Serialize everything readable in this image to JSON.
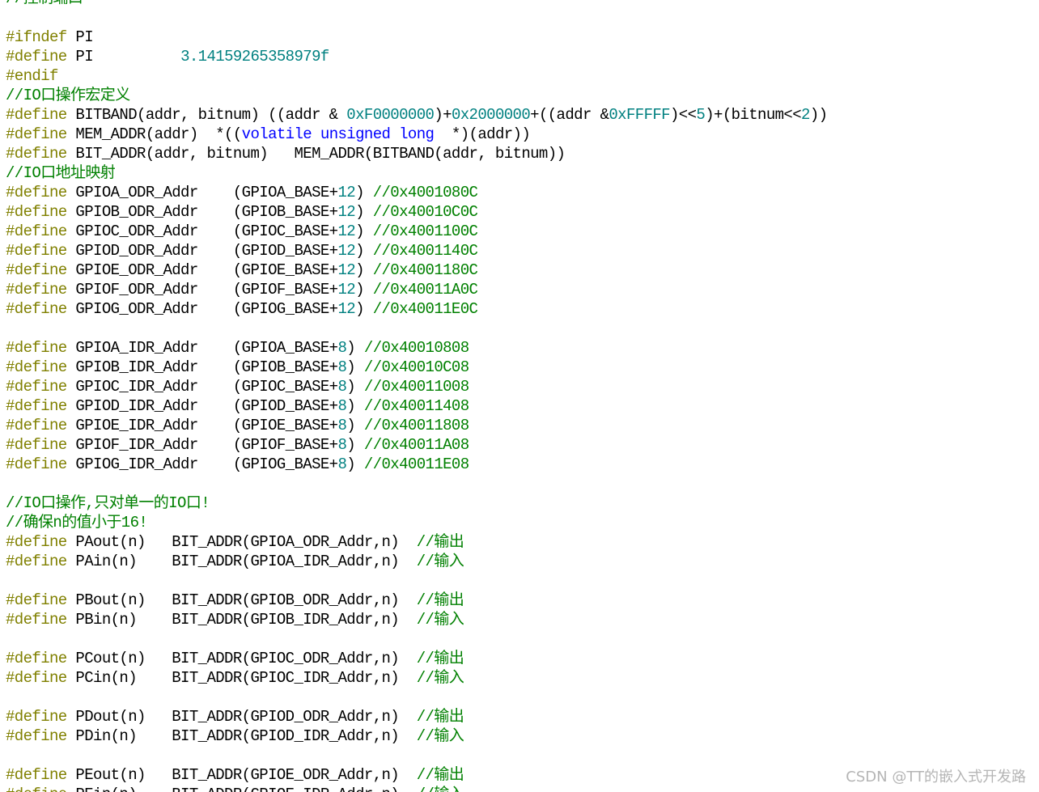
{
  "code_lines": [
    [
      [
        "cmt",
        "//控制端口"
      ]
    ],
    [],
    [
      [
        "pp",
        "#ifndef"
      ],
      [
        "id",
        " PI"
      ]
    ],
    [
      [
        "pp",
        "#define"
      ],
      [
        "id",
        " PI          "
      ],
      [
        "num",
        "3.14159265358979f"
      ]
    ],
    [
      [
        "pp",
        "#endif"
      ]
    ],
    [
      [
        "cmt",
        "//IO口操作宏定义"
      ]
    ],
    [
      [
        "pp",
        "#define"
      ],
      [
        "id",
        " BITBAND(addr, bitnum) ((addr & "
      ],
      [
        "num",
        "0xF0000000"
      ],
      [
        "id",
        ")+"
      ],
      [
        "num",
        "0x2000000"
      ],
      [
        "id",
        "+((addr &"
      ],
      [
        "num",
        "0xFFFFF"
      ],
      [
        "id",
        ")<<"
      ],
      [
        "num",
        "5"
      ],
      [
        "id",
        ")+(bitnum<<"
      ],
      [
        "num",
        "2"
      ],
      [
        "id",
        "))"
      ]
    ],
    [
      [
        "pp",
        "#define"
      ],
      [
        "id",
        " MEM_ADDR(addr)  *(("
      ],
      [
        "kw",
        "volatile unsigned long"
      ],
      [
        "id",
        "  *)(addr))"
      ]
    ],
    [
      [
        "pp",
        "#define"
      ],
      [
        "id",
        " BIT_ADDR(addr, bitnum)   MEM_ADDR(BITBAND(addr, bitnum))"
      ]
    ],
    [
      [
        "cmt",
        "//IO口地址映射"
      ]
    ],
    [
      [
        "pp",
        "#define"
      ],
      [
        "id",
        " GPIOA_ODR_Addr    (GPIOA_BASE+"
      ],
      [
        "num",
        "12"
      ],
      [
        "id",
        ") "
      ],
      [
        "cmt",
        "//0x4001080C"
      ]
    ],
    [
      [
        "pp",
        "#define"
      ],
      [
        "id",
        " GPIOB_ODR_Addr    (GPIOB_BASE+"
      ],
      [
        "num",
        "12"
      ],
      [
        "id",
        ") "
      ],
      [
        "cmt",
        "//0x40010C0C"
      ]
    ],
    [
      [
        "pp",
        "#define"
      ],
      [
        "id",
        " GPIOC_ODR_Addr    (GPIOC_BASE+"
      ],
      [
        "num",
        "12"
      ],
      [
        "id",
        ") "
      ],
      [
        "cmt",
        "//0x4001100C"
      ]
    ],
    [
      [
        "pp",
        "#define"
      ],
      [
        "id",
        " GPIOD_ODR_Addr    (GPIOD_BASE+"
      ],
      [
        "num",
        "12"
      ],
      [
        "id",
        ") "
      ],
      [
        "cmt",
        "//0x4001140C"
      ]
    ],
    [
      [
        "pp",
        "#define"
      ],
      [
        "id",
        " GPIOE_ODR_Addr    (GPIOE_BASE+"
      ],
      [
        "num",
        "12"
      ],
      [
        "id",
        ") "
      ],
      [
        "cmt",
        "//0x4001180C"
      ]
    ],
    [
      [
        "pp",
        "#define"
      ],
      [
        "id",
        " GPIOF_ODR_Addr    (GPIOF_BASE+"
      ],
      [
        "num",
        "12"
      ],
      [
        "id",
        ") "
      ],
      [
        "cmt",
        "//0x40011A0C"
      ]
    ],
    [
      [
        "pp",
        "#define"
      ],
      [
        "id",
        " GPIOG_ODR_Addr    (GPIOG_BASE+"
      ],
      [
        "num",
        "12"
      ],
      [
        "id",
        ") "
      ],
      [
        "cmt",
        "//0x40011E0C"
      ]
    ],
    [],
    [
      [
        "pp",
        "#define"
      ],
      [
        "id",
        " GPIOA_IDR_Addr    (GPIOA_BASE+"
      ],
      [
        "num",
        "8"
      ],
      [
        "id",
        ") "
      ],
      [
        "cmt",
        "//0x40010808"
      ]
    ],
    [
      [
        "pp",
        "#define"
      ],
      [
        "id",
        " GPIOB_IDR_Addr    (GPIOB_BASE+"
      ],
      [
        "num",
        "8"
      ],
      [
        "id",
        ") "
      ],
      [
        "cmt",
        "//0x40010C08"
      ]
    ],
    [
      [
        "pp",
        "#define"
      ],
      [
        "id",
        " GPIOC_IDR_Addr    (GPIOC_BASE+"
      ],
      [
        "num",
        "8"
      ],
      [
        "id",
        ") "
      ],
      [
        "cmt",
        "//0x40011008"
      ]
    ],
    [
      [
        "pp",
        "#define"
      ],
      [
        "id",
        " GPIOD_IDR_Addr    (GPIOD_BASE+"
      ],
      [
        "num",
        "8"
      ],
      [
        "id",
        ") "
      ],
      [
        "cmt",
        "//0x40011408"
      ]
    ],
    [
      [
        "pp",
        "#define"
      ],
      [
        "id",
        " GPIOE_IDR_Addr    (GPIOE_BASE+"
      ],
      [
        "num",
        "8"
      ],
      [
        "id",
        ") "
      ],
      [
        "cmt",
        "//0x40011808"
      ]
    ],
    [
      [
        "pp",
        "#define"
      ],
      [
        "id",
        " GPIOF_IDR_Addr    (GPIOF_BASE+"
      ],
      [
        "num",
        "8"
      ],
      [
        "id",
        ") "
      ],
      [
        "cmt",
        "//0x40011A08"
      ]
    ],
    [
      [
        "pp",
        "#define"
      ],
      [
        "id",
        " GPIOG_IDR_Addr    (GPIOG_BASE+"
      ],
      [
        "num",
        "8"
      ],
      [
        "id",
        ") "
      ],
      [
        "cmt",
        "//0x40011E08"
      ]
    ],
    [],
    [
      [
        "cmt",
        "//IO口操作,只对单一的IO口!"
      ]
    ],
    [
      [
        "cmt",
        "//确保n的值小于16!"
      ]
    ],
    [
      [
        "pp",
        "#define"
      ],
      [
        "id",
        " PAout(n)   BIT_ADDR(GPIOA_ODR_Addr,n)  "
      ],
      [
        "cmt",
        "//输出"
      ]
    ],
    [
      [
        "pp",
        "#define"
      ],
      [
        "id",
        " PAin(n)    BIT_ADDR(GPIOA_IDR_Addr,n)  "
      ],
      [
        "cmt",
        "//输入"
      ]
    ],
    [],
    [
      [
        "pp",
        "#define"
      ],
      [
        "id",
        " PBout(n)   BIT_ADDR(GPIOB_ODR_Addr,n)  "
      ],
      [
        "cmt",
        "//输出"
      ]
    ],
    [
      [
        "pp",
        "#define"
      ],
      [
        "id",
        " PBin(n)    BIT_ADDR(GPIOB_IDR_Addr,n)  "
      ],
      [
        "cmt",
        "//输入"
      ]
    ],
    [],
    [
      [
        "pp",
        "#define"
      ],
      [
        "id",
        " PCout(n)   BIT_ADDR(GPIOC_ODR_Addr,n)  "
      ],
      [
        "cmt",
        "//输出"
      ]
    ],
    [
      [
        "pp",
        "#define"
      ],
      [
        "id",
        " PCin(n)    BIT_ADDR(GPIOC_IDR_Addr,n)  "
      ],
      [
        "cmt",
        "//输入"
      ]
    ],
    [],
    [
      [
        "pp",
        "#define"
      ],
      [
        "id",
        " PDout(n)   BIT_ADDR(GPIOD_ODR_Addr,n)  "
      ],
      [
        "cmt",
        "//输出"
      ]
    ],
    [
      [
        "pp",
        "#define"
      ],
      [
        "id",
        " PDin(n)    BIT_ADDR(GPIOD_IDR_Addr,n)  "
      ],
      [
        "cmt",
        "//输入"
      ]
    ],
    [],
    [
      [
        "pp",
        "#define"
      ],
      [
        "id",
        " PEout(n)   BIT_ADDR(GPIOE_ODR_Addr,n)  "
      ],
      [
        "cmt",
        "//输出"
      ]
    ],
    [
      [
        "pp",
        "#define"
      ],
      [
        "id",
        " PEin(n)    BIT_ADDR(GPIOE_IDR_Addr,n)  "
      ],
      [
        "cmt",
        "//输入"
      ]
    ]
  ],
  "watermark": "CSDN @TT的嵌入式开发路",
  "colors": {
    "preprocessor": "#808000",
    "number": "#008080",
    "comment": "#008000",
    "keyword": "#0000ff",
    "text": "#000000",
    "background": "#ffffff"
  }
}
